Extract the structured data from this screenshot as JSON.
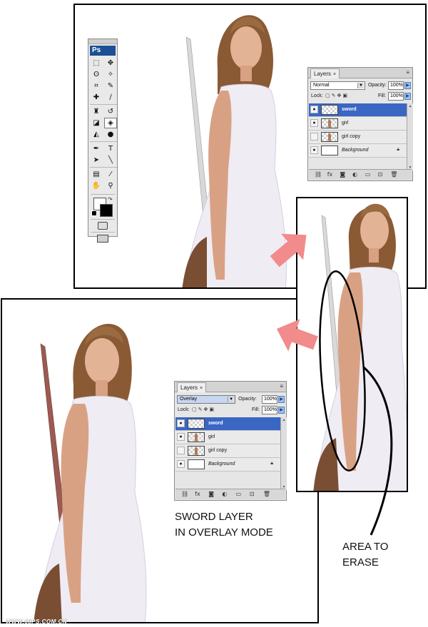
{
  "toolbox": {
    "logo": "Ps",
    "tools": [
      {
        "icon": "marquee-icon",
        "glyph": "⬚"
      },
      {
        "icon": "move-icon",
        "glyph": "✥"
      },
      {
        "icon": "lasso-icon",
        "glyph": "ʘ"
      },
      {
        "icon": "magic-wand-icon",
        "glyph": "✧"
      },
      {
        "icon": "crop-icon",
        "glyph": "⌗"
      },
      {
        "icon": "eyedropper-icon",
        "glyph": "✎"
      },
      {
        "icon": "healing-brush-icon",
        "glyph": "✚"
      },
      {
        "icon": "brush-icon",
        "glyph": "∕"
      },
      {
        "icon": "clone-stamp-icon",
        "glyph": "♜"
      },
      {
        "icon": "history-brush-icon",
        "glyph": "↺"
      },
      {
        "icon": "eraser-icon",
        "glyph": "◪"
      },
      {
        "icon": "paint-bucket-icon",
        "glyph": "◈"
      },
      {
        "icon": "blur-icon",
        "glyph": "◭"
      },
      {
        "icon": "dodge-icon",
        "glyph": "●"
      },
      {
        "icon": "pen-icon",
        "glyph": "✒"
      },
      {
        "icon": "type-icon",
        "glyph": "T"
      },
      {
        "icon": "path-select-icon",
        "glyph": "➤"
      },
      {
        "icon": "line-icon",
        "glyph": "╲"
      },
      {
        "icon": "notes-icon",
        "glyph": "▤"
      },
      {
        "icon": "eyedropper-tool-icon",
        "glyph": "⁄"
      },
      {
        "icon": "hand-icon",
        "glyph": "✋"
      },
      {
        "icon": "zoom-icon",
        "glyph": "⚲"
      }
    ]
  },
  "panel_top": {
    "tab_label": "Layers",
    "close_glyph": "×",
    "menu_glyph": "≡",
    "blend_mode": "Normal",
    "opacity_label": "Opacity:",
    "opacity_value": "100%",
    "lock_label": "Lock:",
    "fill_label": "Fill:",
    "fill_value": "100%",
    "layers": [
      {
        "name": "sword",
        "selected": true,
        "visible": true,
        "thumb": "transparent"
      },
      {
        "name": "girl",
        "selected": false,
        "visible": true,
        "thumb": "figure"
      },
      {
        "name": "girl copy",
        "selected": false,
        "visible": false,
        "thumb": "figure"
      },
      {
        "name": "Background",
        "selected": false,
        "visible": true,
        "thumb": "white",
        "locked": true
      }
    ]
  },
  "panel_bottom": {
    "tab_label": "Layers",
    "close_glyph": "×",
    "menu_glyph": "≡",
    "blend_mode": "Overlay",
    "opacity_label": "Opacity:",
    "opacity_value": "100%",
    "lock_label": "Lock:",
    "fill_label": "Fill:",
    "fill_value": "100%",
    "layers": [
      {
        "name": "sword",
        "selected": true,
        "visible": true,
        "thumb": "transparent"
      },
      {
        "name": "girl",
        "selected": false,
        "visible": true,
        "thumb": "figure"
      },
      {
        "name": "girl copy",
        "selected": false,
        "visible": false,
        "thumb": "figure"
      },
      {
        "name": "Background",
        "selected": false,
        "visible": true,
        "thumb": "white",
        "locked": true
      }
    ]
  },
  "captions": {
    "sword_line1": "SWORD LAYER",
    "sword_line2": "IN OVERLAY MODE",
    "erase_line1": "AREA TO",
    "erase_line2": "ERASE"
  },
  "watermark": "WWW.68PS.COM.CN",
  "colors": {
    "arrow": "#f28b8b",
    "selected_layer": "#3a66c4",
    "skin": "#d9a184",
    "hair": "#8a5a35",
    "dress": "#eeeaf4"
  }
}
